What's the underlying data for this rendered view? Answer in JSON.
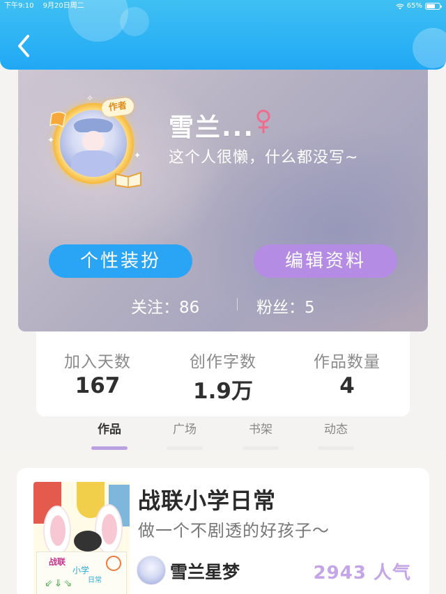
{
  "status_bar": {
    "time": "下午9:10",
    "date": "9月20日周二",
    "battery": "65%",
    "battery_level": 0.65
  },
  "header": {
    "back_icon": "chevron-left-icon"
  },
  "profile": {
    "author_badge": "作者",
    "username": "雪兰...",
    "gender_icon": "female-icon",
    "gender_symbol": "♀",
    "bio": "这个人很懒，什么都没写~",
    "buttons": {
      "dressup": "个性装扮",
      "edit": "编辑资料"
    },
    "following_label": "关注：86",
    "fans_label": "粉丝：5"
  },
  "stats": [
    {
      "label": "加入天数",
      "value": "167"
    },
    {
      "label": "创作字数",
      "value": "1.9万"
    },
    {
      "label": "作品数量",
      "value": "4"
    }
  ],
  "tabs": [
    {
      "label": "作品",
      "active": true
    },
    {
      "label": "广场",
      "active": false
    },
    {
      "label": "书架",
      "active": false
    },
    {
      "label": "动态",
      "active": false
    }
  ],
  "work": {
    "cover_texts": [
      "战联",
      "小学",
      "日常"
    ],
    "title": "战联小学日常",
    "description": "做一个不剧透的好孩子～",
    "author": "雪兰星梦",
    "popularity": "2943 人气"
  },
  "colors": {
    "header_blue": "#20a8f4",
    "dressup_button": "#2aa4f4",
    "edit_button": "#b58ce3",
    "tab_active_underline": "#b9a0e2",
    "popularity_text": "#c3a5e8",
    "gender_icon": "#f06b8c"
  }
}
